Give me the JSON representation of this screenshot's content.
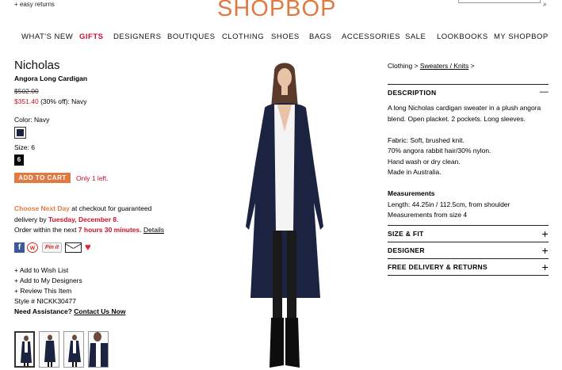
{
  "header": {
    "easy_returns": "+ easy returns",
    "logo": "SHOPBOP",
    "accent_color": "#e07a43"
  },
  "nav": {
    "items": [
      "WHAT'S NEW",
      "GIFTS",
      "DESIGNERS",
      "BOUTIQUES",
      "CLOTHING",
      "SHOES",
      "BAGS",
      "ACCESSORIES",
      "SALE",
      "LOOKBOOKS",
      "MY SHOPBOP"
    ]
  },
  "product": {
    "brand": "Nicholas",
    "name": "Angora Long Cardigan",
    "original_price": "$502.00",
    "sale_price": "$351.40",
    "discount": " (30% off): Navy",
    "color_label": "Color: Navy",
    "size_label": "Size: 6",
    "size_value": "6",
    "add_to_cart": "ADD TO CART",
    "only_left": "Only 1 left.",
    "swatch_color": "#1c2340"
  },
  "delivery": {
    "choose": "Choose Next Day",
    "line1_rest": " at checkout for guaranteed",
    "line2_a": "delivery by ",
    "date": "Tuesday, December 8",
    "line2_end": ".",
    "line3_a": "Order within the next ",
    "time": "7 hours 30 minutes",
    "line3_b": ". ",
    "details": "Details"
  },
  "share": {
    "facebook": "f",
    "weibo": "w",
    "pinit": "Pin it",
    "heart": "♥"
  },
  "links": {
    "wish": "+ Add to Wish List",
    "designers": "+ Add to My Designers",
    "review": "+ Review This Item",
    "style": "Style # NICKK30477",
    "need": "Need Assistance?",
    "contact": "Contact Us Now"
  },
  "right": {
    "crumb_a": "Clothing > ",
    "crumb_b": "Sweaters / Knits",
    "crumb_c": " >",
    "description_title": "DESCRIPTION",
    "description_sign": "—",
    "desc1": "A long Nicholas cardigan sweater in a plush angora blend. Open placket. 2 pockets. Long sleeves.",
    "fabric1": "Fabric: Soft, brushed knit.",
    "fabric2": "70% angora rabbit hair/30% nylon.",
    "fabric3": "Hand wash or dry clean.",
    "fabric4": "Made in Australia.",
    "measure_title": "Measurements",
    "measure1": "Length: 44.25in / 112.5cm, from shoulder",
    "measure2": "Measurements from size 4",
    "size_fit": "SIZE & FIT",
    "designer": "DESIGNER",
    "free_delivery": "FREE DELIVERY & RETURNS",
    "plus": "+"
  }
}
